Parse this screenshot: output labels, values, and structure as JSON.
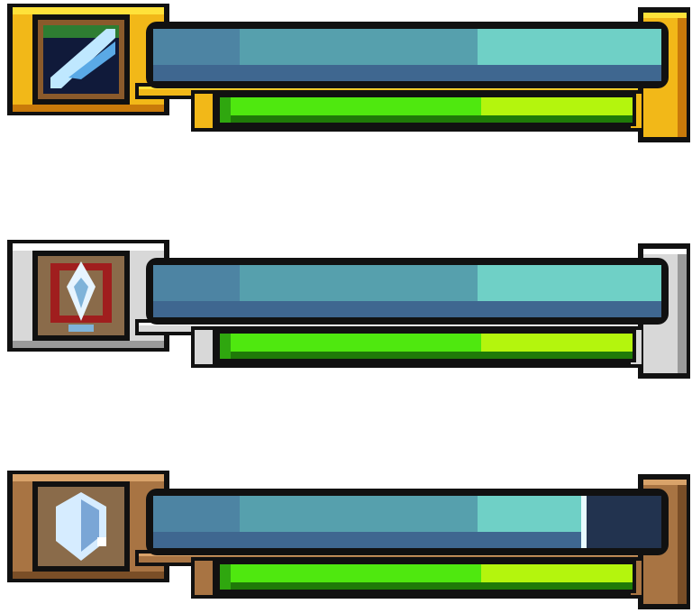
{
  "hud": {
    "units": [
      {
        "id": "gold",
        "frame_tier": "gold",
        "portrait_icon": "sword-slash-icon",
        "shield_fraction": 1.0,
        "health_fraction": 1.0,
        "frame_colors": {
          "outline": "#111111",
          "light": "#ffe23a",
          "mid": "#f2b818",
          "dark": "#c97a0a",
          "deep": "#8a4a06"
        },
        "portrait_colors": {
          "bg": "#101a3a",
          "accent": "#2e7d32",
          "blade": "#bfe8ff",
          "blade_edge": "#5aa9e6"
        }
      },
      {
        "id": "silver",
        "frame_tier": "silver",
        "portrait_icon": "crest-shield-icon",
        "shield_fraction": 1.0,
        "health_fraction": 1.0,
        "frame_colors": {
          "outline": "#111111",
          "light": "#ffffff",
          "mid": "#d8d8d8",
          "dark": "#9a9a9a",
          "deep": "#5a5a5a"
        },
        "portrait_colors": {
          "bg": "#8a6b4a",
          "accent": "#a01e1e",
          "blade": "#e6f4ff",
          "blade_edge": "#7fb3d9"
        }
      },
      {
        "id": "bronze",
        "frame_tier": "bronze",
        "portrait_icon": "crystal-gem-icon",
        "shield_fraction": 0.85,
        "health_fraction": 1.0,
        "frame_colors": {
          "outline": "#111111",
          "light": "#d9a36a",
          "mid": "#a87443",
          "dark": "#7a4e27",
          "deep": "#4a2d14"
        },
        "portrait_colors": {
          "bg": "#8a6b4a",
          "accent": "#4a6fa5",
          "blade": "#d6ecff",
          "blade_edge": "#7aa6d6"
        }
      }
    ],
    "bar_colors": {
      "shield_top": "#4d84a3",
      "shield_mid": "#56a0ad",
      "shield_bright": "#6fd0c6",
      "shield_shadow": "#3f6790",
      "shield_empty": "#22334f",
      "health_dark": "#2fa70f",
      "health_mid": "#4fe80f",
      "health_bright": "#b4f50d",
      "health_shadow": "#1f7a08"
    }
  }
}
